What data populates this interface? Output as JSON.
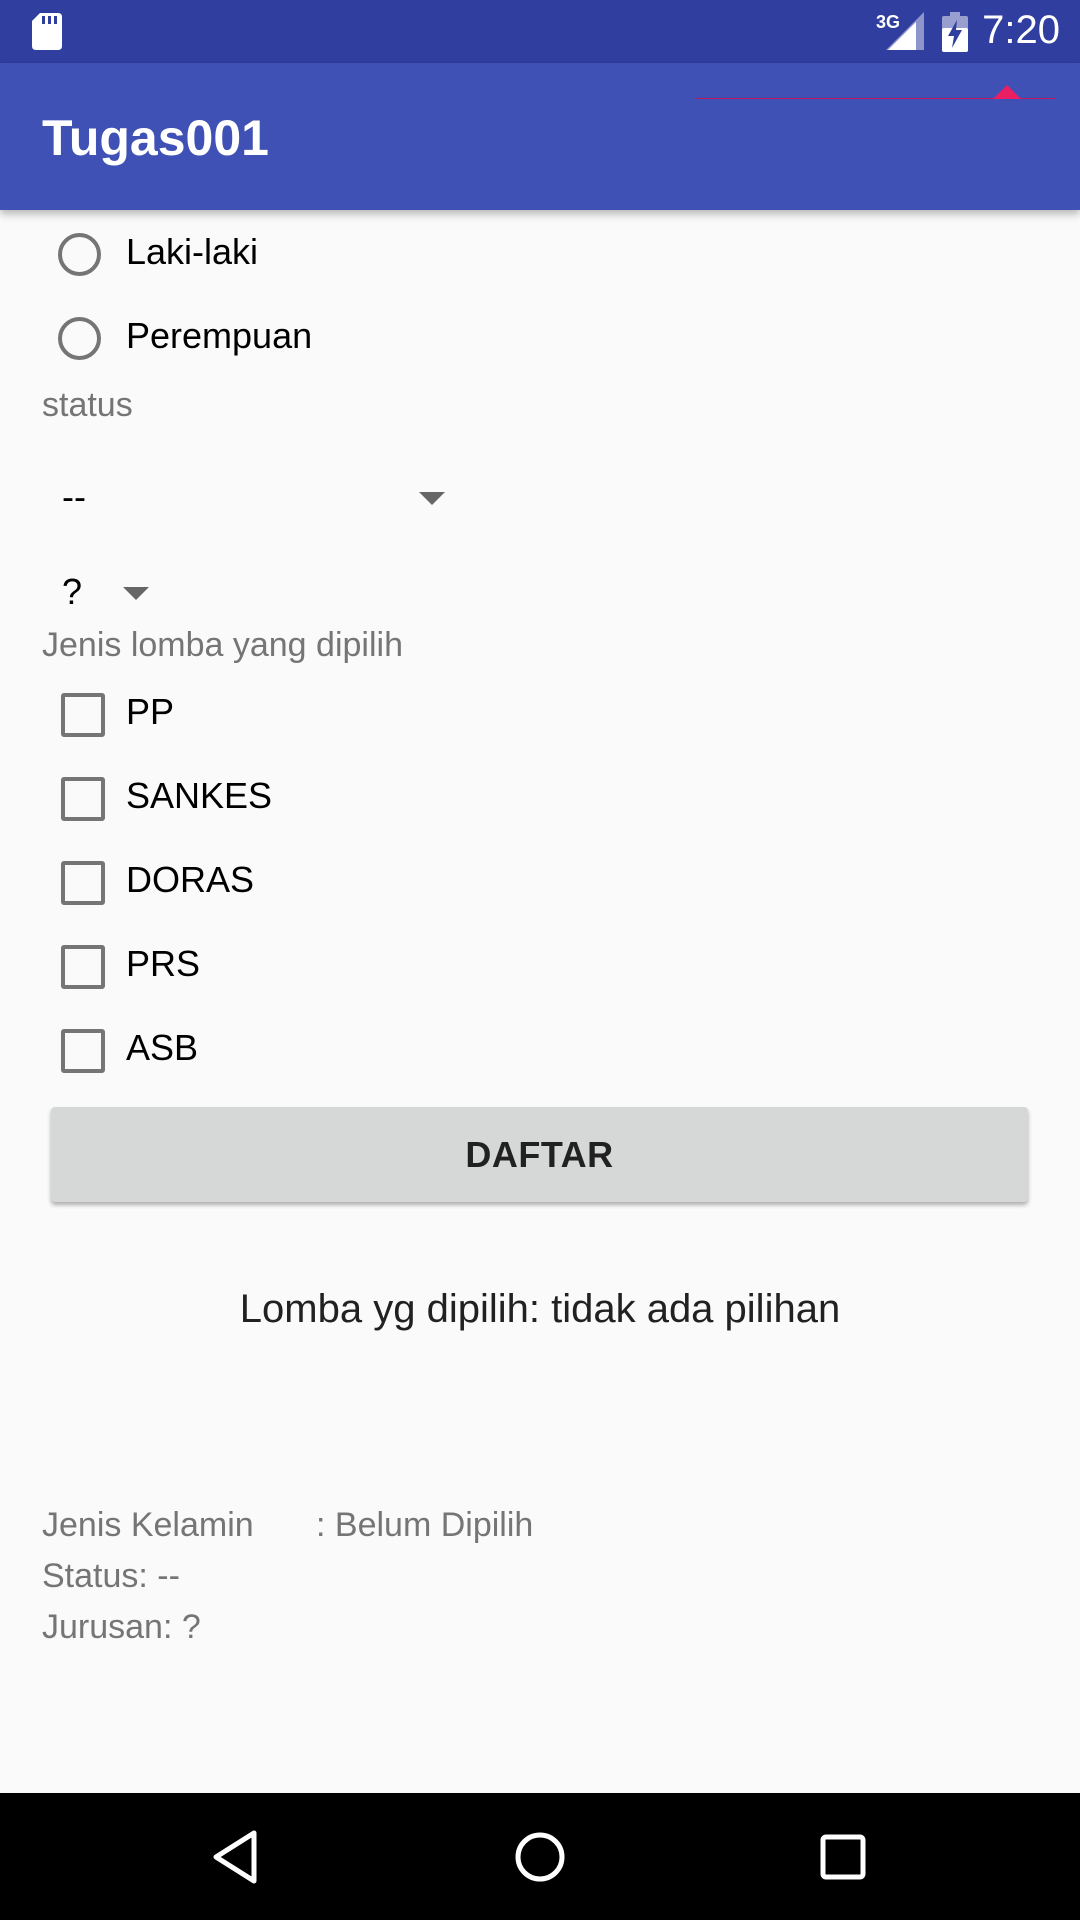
{
  "status_bar": {
    "network": "3G",
    "time": "7:20"
  },
  "app_bar": {
    "title": "Tugas001"
  },
  "gender": {
    "options": [
      "Laki-laki",
      "Perempuan"
    ]
  },
  "status": {
    "label": "status",
    "selected": "--"
  },
  "jurusan": {
    "selected": "?"
  },
  "lomba": {
    "label": "Jenis lomba yang dipilih",
    "options": [
      "PP",
      "SANKES",
      "DORAS",
      "PRS",
      "ASB"
    ]
  },
  "daftar_button": "DAFTAR",
  "result": "Lomba yg dipilih: tidak ada pilihan",
  "summary": {
    "gender_label": "Jenis Kelamin",
    "gender_value": ": Belum Dipilih",
    "status_line": "Status:  --",
    "jurusan_line": "Jurusan:  ?"
  },
  "colors": {
    "status_bar": "#303f9f",
    "app_bar": "#3f51b5",
    "accent": "#e91e63"
  },
  "icons": {
    "status_left": "sd-card-icon",
    "signal": "signal-icon",
    "battery": "battery-charging-icon",
    "nav_back": "back-icon",
    "nav_home": "home-icon",
    "nav_recents": "recents-icon"
  }
}
